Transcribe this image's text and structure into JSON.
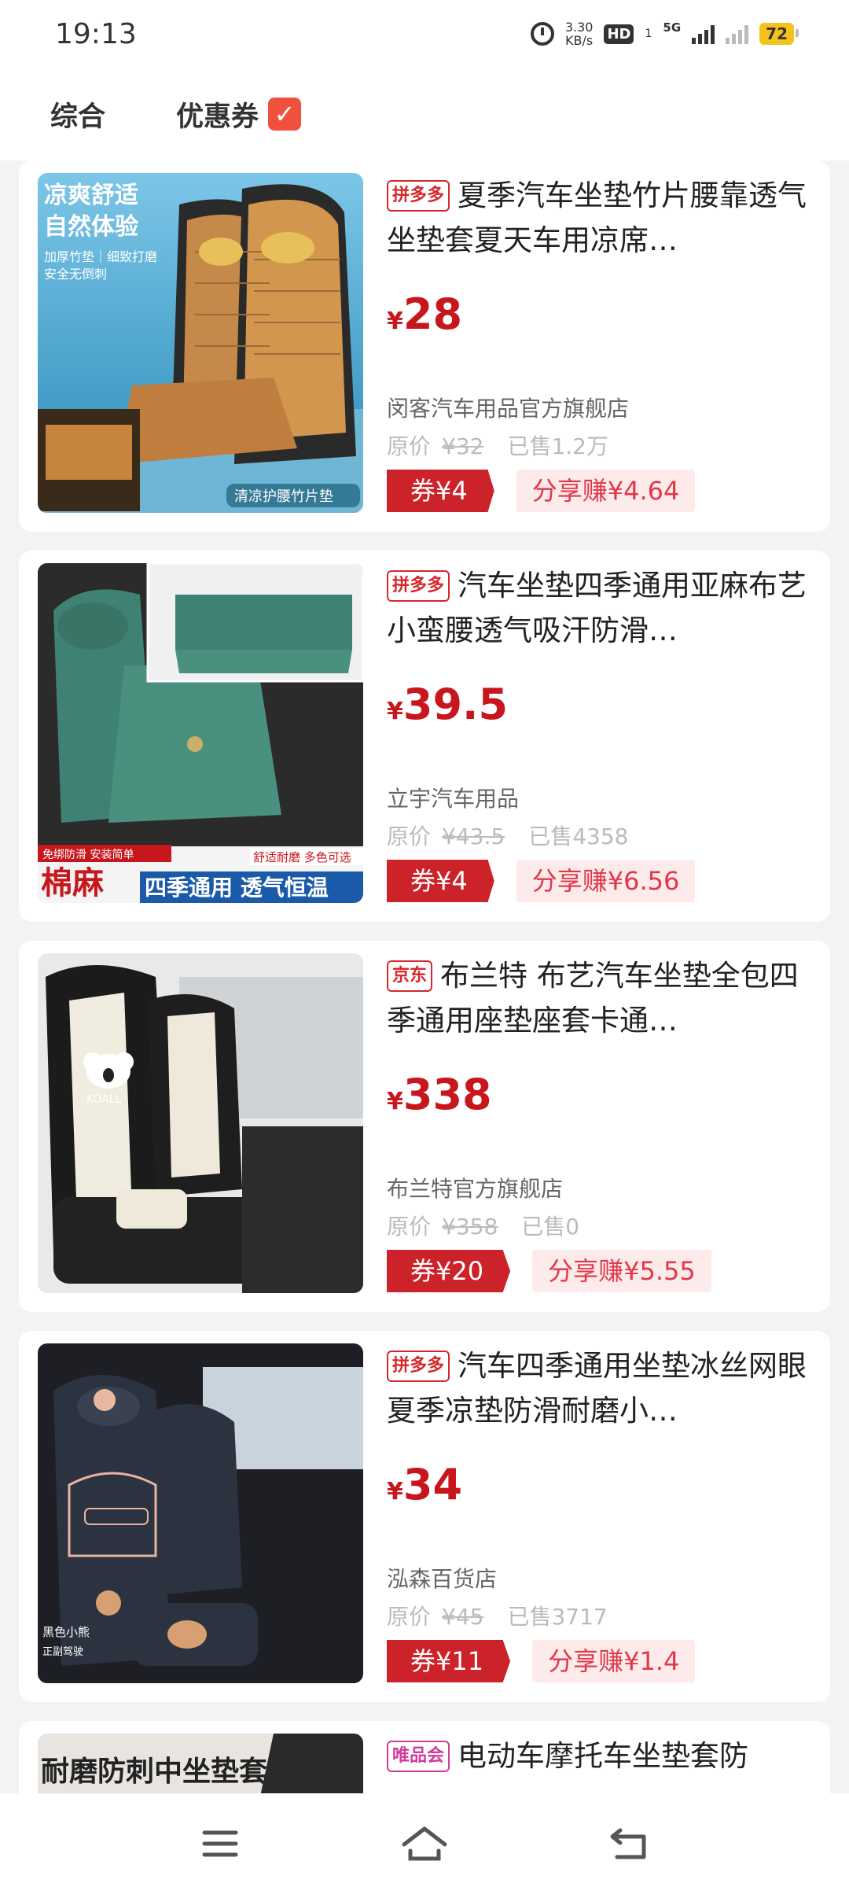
{
  "status": {
    "time": "19:13",
    "speed_value": "3.30",
    "speed_unit": "KB/s",
    "hd": "HD",
    "hd_sub": "1",
    "network": "5G",
    "battery": "72"
  },
  "filters": {
    "all": "综合",
    "coupon": "优惠券",
    "coupon_checked": true
  },
  "products": [
    {
      "platform": "拼多多",
      "title": "夏季汽车坐垫竹片腰靠透气坐垫套夏天车用凉席…",
      "yen": "¥",
      "price": "28",
      "shop": "闵客汽车用品官方旗舰店",
      "orig_label": "原价",
      "orig_price": "¥32",
      "sold": "已售1.2万",
      "coupon": "券¥4",
      "share": "分享赚¥4.64",
      "image_text": [
        "凉爽舒适",
        "自然体验",
        "加厚竹垫｜细致打磨",
        "安全无倒刺",
        "清凉护腰竹片垫"
      ]
    },
    {
      "platform": "拼多多",
      "title": "汽车坐垫四季通用亚麻布艺小蛮腰透气吸汗防滑…",
      "yen": "¥",
      "price": "39.5",
      "shop": "立宇汽车用品",
      "orig_label": "原价",
      "orig_price": "¥43.5",
      "sold": "已售4358",
      "coupon": "券¥4",
      "share": "分享赚¥6.56",
      "image_text": [
        "免绑防滑 安装简单",
        "舒适耐磨 多色可选",
        "棉麻",
        "四季通用 透气恒温"
      ]
    },
    {
      "platform": "京东",
      "title": "布兰特 布艺汽车坐垫全包四季通用座垫座套卡通…",
      "yen": "¥",
      "price": "338",
      "shop": "布兰特官方旗舰店",
      "orig_label": "原价",
      "orig_price": "¥358",
      "sold": "已售0",
      "coupon": "券¥20",
      "share": "分享赚¥5.55",
      "image_text": [
        "KOALL"
      ]
    },
    {
      "platform": "拼多多",
      "title": "汽车四季通用坐垫冰丝网眼夏季凉垫防滑耐磨小…",
      "yen": "¥",
      "price": "34",
      "shop": "泓森百货店",
      "orig_label": "原价",
      "orig_price": "¥45",
      "sold": "已售3717",
      "coupon": "券¥11",
      "share": "分享赚¥1.4",
      "image_text": [
        "黑色小熊",
        "正副驾驶"
      ]
    },
    {
      "platform": "唯品会",
      "title": "电动车摩托车坐垫套防",
      "image_text": [
        "耐磨防刺中坐垫套"
      ]
    }
  ],
  "colors": {
    "accent": "#c8161d",
    "coupon_bg": "#cc2229",
    "share_bg": "#fdeaea",
    "checkbox": "#f0513f"
  },
  "nav": {
    "icons": [
      "menu-icon",
      "home-icon",
      "back-icon"
    ]
  }
}
